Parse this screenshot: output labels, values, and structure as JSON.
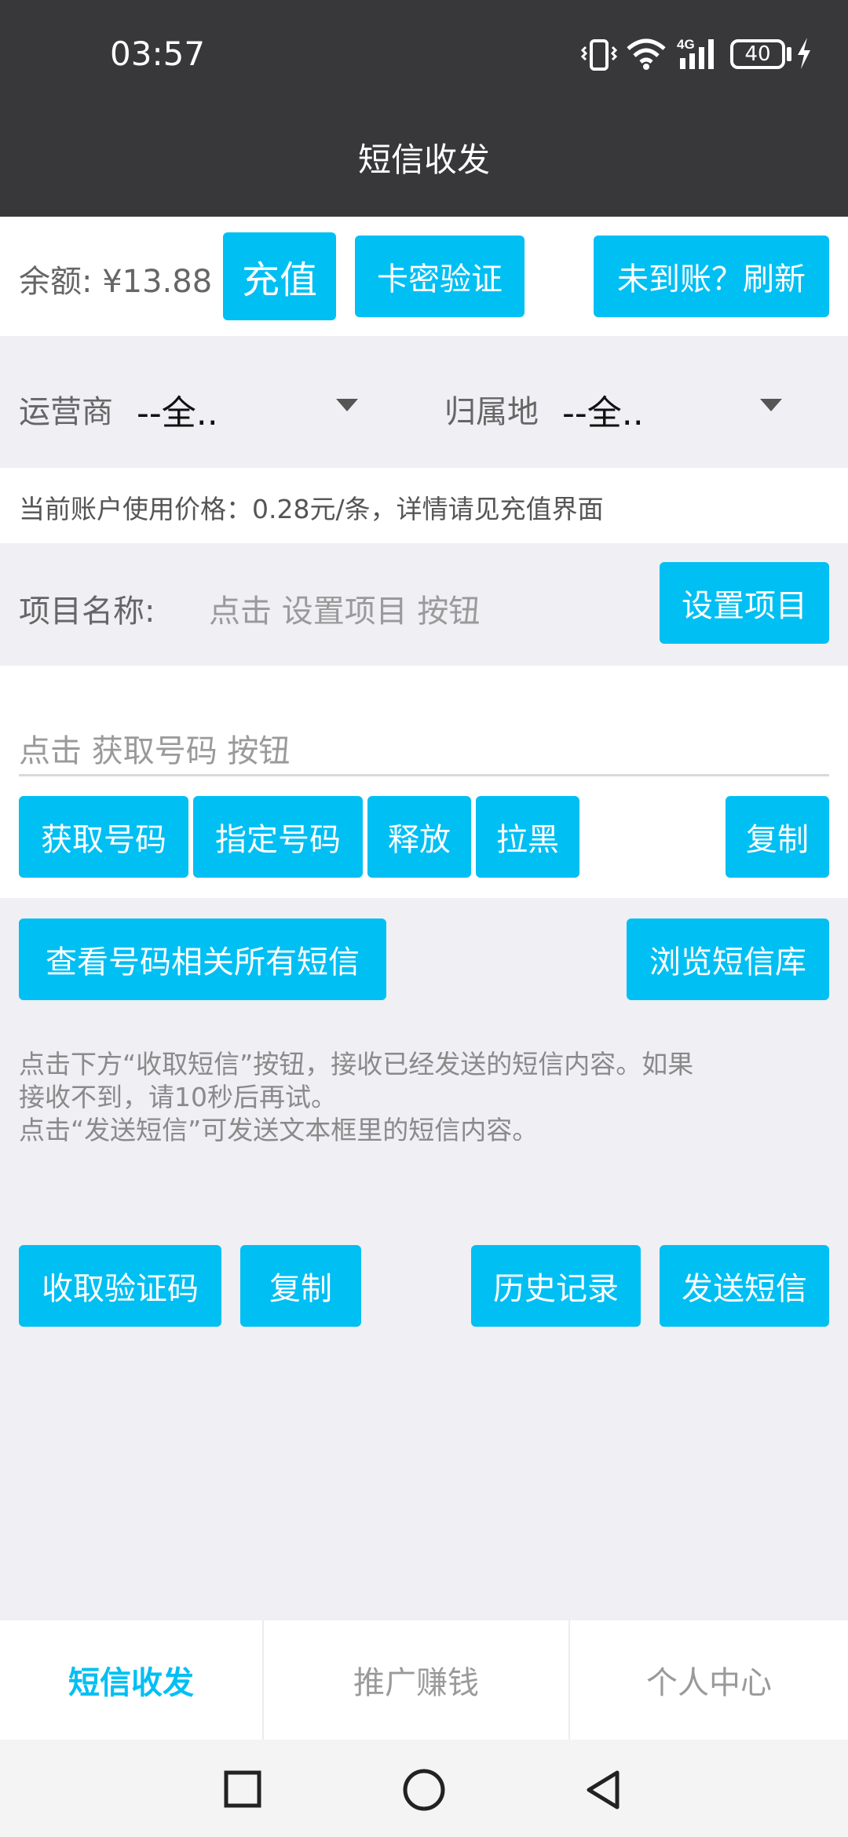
{
  "status_bar": {
    "time": "03:57",
    "battery": "40",
    "network": "4G"
  },
  "header": {
    "title": "短信收发"
  },
  "balance": {
    "label": "余额: ¥13.88",
    "recharge_label": "充值",
    "card_verify_label": "卡密验证",
    "refresh_label": "未到账？刷新"
  },
  "filters": {
    "carrier_label": "运营商",
    "carrier_value": "--全..",
    "region_label": "归属地",
    "region_value": "--全.."
  },
  "price_note": "当前账户使用价格：0.28元/条，详情请见充值界面",
  "project": {
    "label": "项目名称:",
    "placeholder": "点击 设置项目 按钮",
    "set_label": "设置项目"
  },
  "phone": {
    "placeholder": "点击 获取号码 按钮",
    "get_label": "获取号码",
    "specify_label": "指定号码",
    "release_label": "释放",
    "block_label": "拉黑",
    "copy_label": "复制"
  },
  "sms": {
    "view_all_label": "查看号码相关所有短信",
    "browse_label": "浏览短信库",
    "info_lines": [
      "点击下方“收取短信”按钮，接收已经发送的短信内容。如果",
      "接收不到，请10秒后再试。",
      "点击“发送短信”可发送文本框里的短信内容。"
    ],
    "receive_label": "收取验证码",
    "copy_label": "复制",
    "history_label": "历史记录",
    "send_label": "发送短信"
  },
  "tabs": [
    {
      "label": "短信收发",
      "active": true
    },
    {
      "label": "推广赚钱",
      "active": false
    },
    {
      "label": "个人中心",
      "active": false
    }
  ],
  "colors": {
    "accent": "#00bff3",
    "header": "#38383b"
  },
  "nav_icons": [
    "recent-apps-icon",
    "home-icon",
    "back-icon"
  ]
}
